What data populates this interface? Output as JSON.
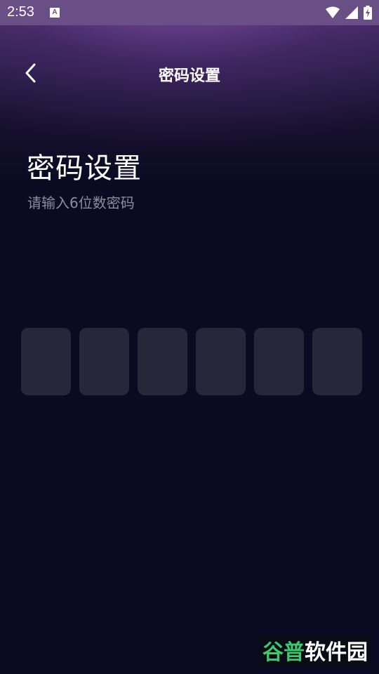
{
  "status_bar": {
    "time": "2:53",
    "notification_icon": "a-icon",
    "icons": [
      "wifi-icon",
      "signal-icon",
      "battery-icon"
    ]
  },
  "header": {
    "title": "密码设置",
    "back_icon": "chevron-left-icon"
  },
  "main": {
    "title": "密码设置",
    "subtitle": "请输入6位数密码",
    "pin_length": 6,
    "pin_boxes": [
      "",
      "",
      "",
      "",
      "",
      ""
    ]
  },
  "watermark": {
    "part1": "谷普",
    "part2": "软件园"
  },
  "colors": {
    "background": "#0c0a22",
    "pin_box": "#272739",
    "subtitle": "#8f8b9c",
    "accent_green": "#3ec86d"
  }
}
